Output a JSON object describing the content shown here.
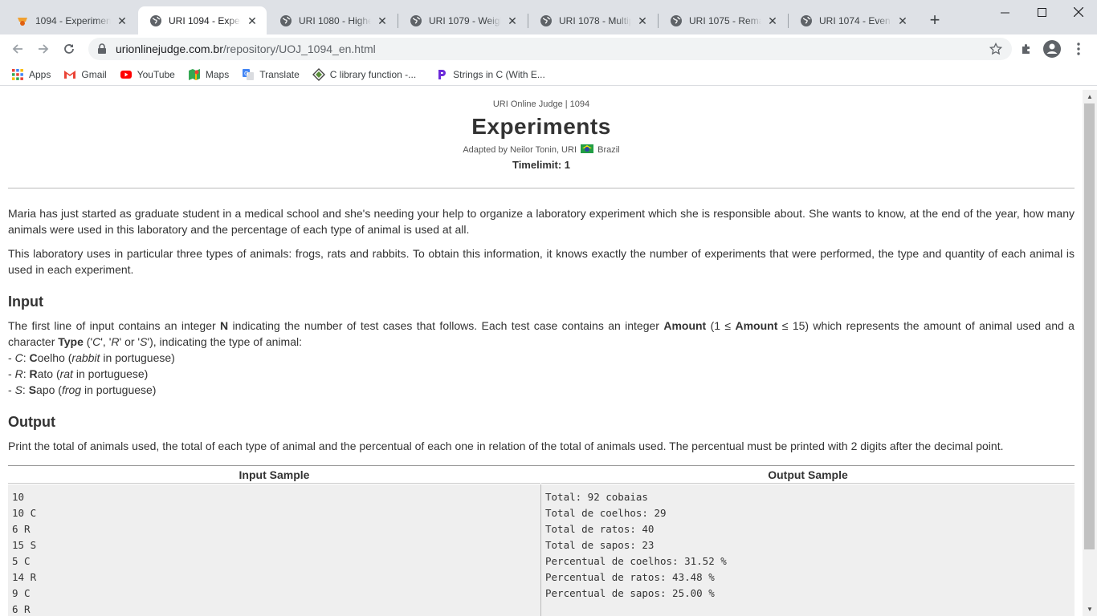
{
  "tabs": [
    {
      "title": "1094 - Experiment",
      "active": false
    },
    {
      "title": "URI 1094 - Experin",
      "active": true
    },
    {
      "title": "URI 1080 - Highes",
      "active": false
    },
    {
      "title": "URI 1079 - Weight",
      "active": false
    },
    {
      "title": "URI 1078 - Multipl",
      "active": false
    },
    {
      "title": "URI 1075 - Remain",
      "active": false
    },
    {
      "title": "URI 1074 - Even o",
      "active": false
    }
  ],
  "address": {
    "host": "urionlinejudge.com.br",
    "path": "/repository/UOJ_1094_en.html"
  },
  "bookmarks": [
    {
      "label": "Apps",
      "icon": "apps-grid-icon"
    },
    {
      "label": "Gmail",
      "icon": "gmail-icon"
    },
    {
      "label": "YouTube",
      "icon": "youtube-icon"
    },
    {
      "label": "Maps",
      "icon": "maps-icon"
    },
    {
      "label": "Translate",
      "icon": "translate-icon"
    },
    {
      "label": "C library function -...",
      "icon": "diamond-icon"
    },
    {
      "label": "Strings in C (With E...",
      "icon": "programiz-icon"
    }
  ],
  "page": {
    "breadcrumb": "URI Online Judge | 1094",
    "title": "Experiments",
    "adapted_prefix": "Adapted by Neilor Tonin, URI",
    "adapted_country": "Brazil",
    "timelimit": "Timelimit: 1",
    "intro_1": "Maria has just started as graduate student in a medical school and she's needing your help to organize a laboratory experiment which she is responsible about. She wants to know, at the end of the year, how many animals were used in this laboratory and the percentage of each type of animal is used at all.",
    "intro_2": "This laboratory uses in particular three types of animals: frogs, rats and rabbits. To obtain this information, it knows exactly the number of experiments that were performed, the type and quantity of each animal is used in each experiment.",
    "input_heading": "Input",
    "input_text": {
      "a": "The first line of input contains an integer ",
      "n": "N",
      "b": " indicating the number of test cases that follows. Each test case contains an integer ",
      "amount": "Amount",
      "c": " (1 ≤ ",
      "amount2": "Amount",
      "d": " ≤ 15) which represents the amount of animal used and a character ",
      "type": "Type",
      "e": " ('",
      "c_letter": "C",
      "f": "', '",
      "r_letter": "R",
      "g": "' or '",
      "s_letter": "S",
      "h": "'), indicating the type of animal:"
    },
    "animals": [
      {
        "dash": "- ",
        "code": "C",
        "colon": ": ",
        "first": "C",
        "rest": "oelho (",
        "pt": "rabbit",
        "tail": " in portuguese)"
      },
      {
        "dash": "- ",
        "code": "R",
        "colon": ": ",
        "first": "R",
        "rest": "ato (",
        "pt": "rat",
        "tail": "  in portuguese)"
      },
      {
        "dash": "- ",
        "code": "S",
        "colon": ": ",
        "first": "S",
        "rest": "apo (",
        "pt": "frog",
        "tail": " in portuguese)"
      }
    ],
    "output_heading": "Output",
    "output_text": "Print the total of animals used, the total of each type of animal and the percentual of each one in relation of the total of animals used. The percentual must be printed with 2 digits after the decimal point.",
    "input_sample_label": "Input Sample",
    "output_sample_label": "Output Sample",
    "input_sample": [
      "10",
      "10 C",
      "6 R",
      "15 S",
      "5 C",
      "14 R",
      "9 C",
      "6 R"
    ],
    "output_sample": [
      "Total: 92 cobaias",
      "Total de coelhos: 29",
      "Total de ratos: 40",
      "Total de sapos: 23",
      "Percentual de coelhos: 31.52 %",
      "Percentual de ratos: 43.48 %",
      "Percentual de sapos: 25.00 %"
    ]
  }
}
